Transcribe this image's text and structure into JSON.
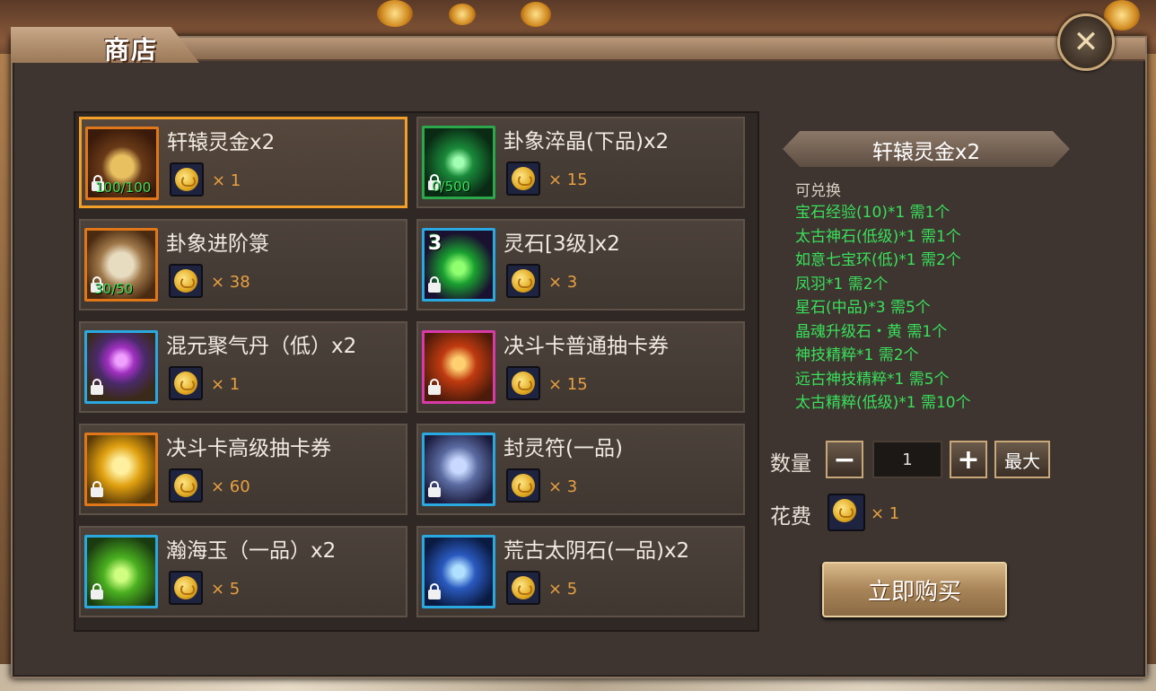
{
  "shop": {
    "title": "商店",
    "items": [
      {
        "name": "轩辕灵金x2",
        "price": "× 1",
        "rarity_color": "#e0781a",
        "progress": "100/100",
        "level": "",
        "icon": "gold-ingot-chest-icon"
      },
      {
        "name": "卦象淬晶(下品)x2",
        "price": "× 15",
        "rarity_color": "#2aa84a",
        "progress": "0/500",
        "level": "",
        "icon": "green-crystal-icon"
      },
      {
        "name": "卦象进阶箓",
        "price": "× 38",
        "rarity_color": "#e0781a",
        "progress": "30/50",
        "level": "",
        "icon": "scroll-icon"
      },
      {
        "name": "灵石[3级]x2",
        "price": "× 3",
        "rarity_color": "#2aa8e0",
        "progress": "",
        "level": "3",
        "icon": "green-gem-icon"
      },
      {
        "name": "混元聚气丹（低）x2",
        "price": "× 1",
        "rarity_color": "#2aa8e0",
        "progress": "",
        "level": "",
        "icon": "purple-orb-icon"
      },
      {
        "name": "决斗卡普通抽卡券",
        "price": "× 15",
        "rarity_color": "#d83aa8",
        "progress": "",
        "level": "",
        "icon": "red-card-icon"
      },
      {
        "name": "决斗卡高级抽卡券",
        "price": "× 60",
        "rarity_color": "#e0781a",
        "progress": "",
        "level": "",
        "icon": "gold-card-icon"
      },
      {
        "name": "封灵符(一品)",
        "price": "× 3",
        "rarity_color": "#2aa8e0",
        "progress": "",
        "level": "",
        "icon": "talisman-icon"
      },
      {
        "name": "瀚海玉（一品）x2",
        "price": "× 5",
        "rarity_color": "#2aa8e0",
        "progress": "",
        "level": "",
        "icon": "jade-pendant-icon"
      },
      {
        "name": "荒古太阴石(一品)x2",
        "price": "× 5",
        "rarity_color": "#2aa8e0",
        "progress": "",
        "level": "",
        "icon": "blue-stone-icon"
      }
    ]
  },
  "detail": {
    "title": "轩辕灵金x2",
    "exchangeable_label": "可兑换",
    "rewards": [
      "宝石经验(10)*1 需1个",
      "太古神石(低级)*1 需1个",
      "如意七宝环(低)*1 需2个",
      "凤羽*1 需2个",
      "星石(中品)*3  需5个",
      "晶魂升级石・黄 需1个",
      "神技精粹*1 需2个",
      "远古神技精粹*1  需5个",
      "太古精粹(低级)*1  需10个"
    ],
    "reward_color": "#38e05a",
    "quantity_label": "数量",
    "quantity_value": "1",
    "minus": "−",
    "plus": "+",
    "max_label": "最大",
    "cost_label": "花费",
    "cost_amount": "× 1",
    "buy_label": "立即购买"
  }
}
